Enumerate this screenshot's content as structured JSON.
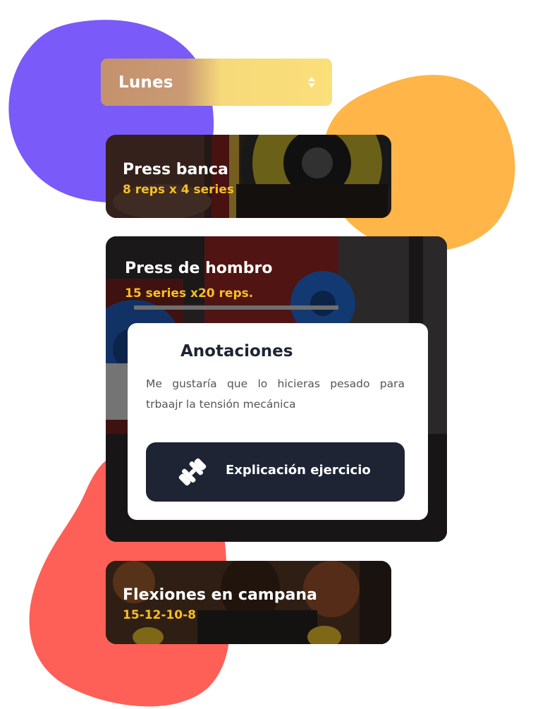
{
  "day_selector": {
    "selected": "Lunes"
  },
  "exercises": [
    {
      "name": "Press banca",
      "detail": "8 reps x 4 series"
    },
    {
      "name": "Press de hombro",
      "detail": "15 series x20 reps."
    },
    {
      "name": "Flexiones en campana",
      "detail": "15-12-10-8"
    }
  ],
  "notes": {
    "title": "Anotaciones",
    "body": "Me gustaría que lo hicieras pesado para trbaajr la tensión mecánica",
    "button_label": "Explicación ejercicio",
    "button_icon": "dumbbell-icon"
  },
  "colors": {
    "blob_purple": "#7a5af8",
    "blob_orange": "#ffb547",
    "blob_red": "#fe5f57",
    "accent_yellow": "#f9bf22",
    "dark_navy": "#1e2433",
    "selector_start": "#c4926e",
    "selector_end": "#fbdf7a"
  }
}
